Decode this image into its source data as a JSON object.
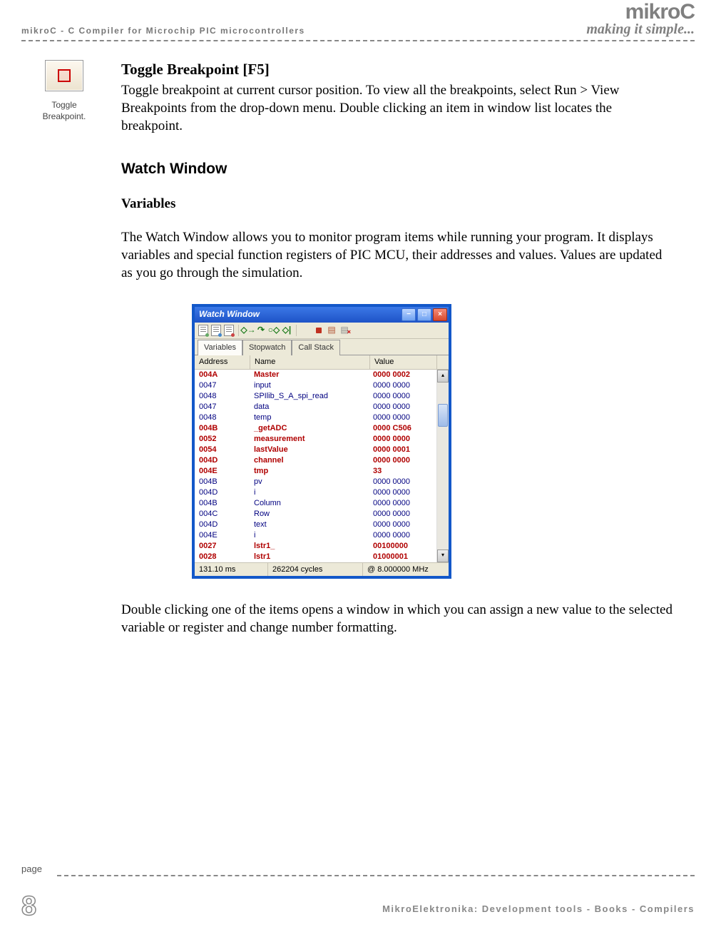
{
  "header": {
    "left_line": "mikroC - C Compiler for Microchip PIC microcontrollers",
    "logo": "mikroC",
    "tagline": "making it simple..."
  },
  "sidebar": {
    "caption_line1": "Toggle",
    "caption_line2": "Breakpoint."
  },
  "body": {
    "toggle_heading": "Toggle Breakpoint [F5]",
    "toggle_paragraph": "Toggle breakpoint at current cursor position. To view all the breakpoints, select Run > View Breakpoints from the drop-down menu. Double clicking an item in window list locates the breakpoint.",
    "watch_heading": "Watch Window",
    "variables_heading": "Variables",
    "variables_paragraph": "The Watch Window allows you to monitor program items while running your program. It displays variables and special function registers of PIC MCU, their addresses and values. Values are updated as you go through the simulation.",
    "after_paragraph": "Double clicking one of the items opens a window in which you can assign a new value to the selected variable or register and change number formatting."
  },
  "watch_window": {
    "title": "Watch Window",
    "tabs": {
      "t1": "Variables",
      "t2": "Stopwatch",
      "t3": "Call Stack"
    },
    "columns": {
      "c1": "Address",
      "c2": "Name",
      "c3": "Value"
    },
    "rows": [
      {
        "addr": "004A",
        "name": "Master",
        "value": "0000 0002",
        "bold": true
      },
      {
        "addr": "0047",
        "name": "input",
        "value": "0000 0000",
        "bold": false
      },
      {
        "addr": "0048",
        "name": "SPIlib_S_A_spi_read",
        "value": "0000 0000",
        "bold": false
      },
      {
        "addr": "0047",
        "name": "data",
        "value": "0000 0000",
        "bold": false
      },
      {
        "addr": "0048",
        "name": "temp",
        "value": "0000 0000",
        "bold": false
      },
      {
        "addr": "004B",
        "name": "_getADC",
        "value": "0000 C506",
        "bold": true
      },
      {
        "addr": "0052",
        "name": "measurement",
        "value": "0000 0000",
        "bold": true
      },
      {
        "addr": "0054",
        "name": "lastValue",
        "value": "0000 0001",
        "bold": true
      },
      {
        "addr": "004D",
        "name": "channel",
        "value": "0000 0000",
        "bold": true
      },
      {
        "addr": "004E",
        "name": "tmp",
        "value": "33",
        "bold": true
      },
      {
        "addr": "004B",
        "name": "pv",
        "value": "0000 0000",
        "bold": false
      },
      {
        "addr": "004D",
        "name": "i",
        "value": "0000 0000",
        "bold": false
      },
      {
        "addr": "004B",
        "name": "Column",
        "value": "0000 0000",
        "bold": false
      },
      {
        "addr": "004C",
        "name": "Row",
        "value": "0000 0000",
        "bold": false
      },
      {
        "addr": "004D",
        "name": "text",
        "value": "0000 0000",
        "bold": false
      },
      {
        "addr": "004E",
        "name": "i",
        "value": "0000 0000",
        "bold": false
      },
      {
        "addr": "0027",
        "name": "lstr1_",
        "value": "00100000",
        "bold": true
      },
      {
        "addr": "0028",
        "name": "lstr1",
        "value": "01000001",
        "bold": true
      }
    ],
    "status": {
      "s1": "131.10 ms",
      "s2": "262204 cycles",
      "s3": "@ 8.000000 MHz"
    }
  },
  "footer": {
    "page_label": "page",
    "page_number": "8",
    "text": "MikroElektronika: Development tools - Books - Compilers"
  }
}
